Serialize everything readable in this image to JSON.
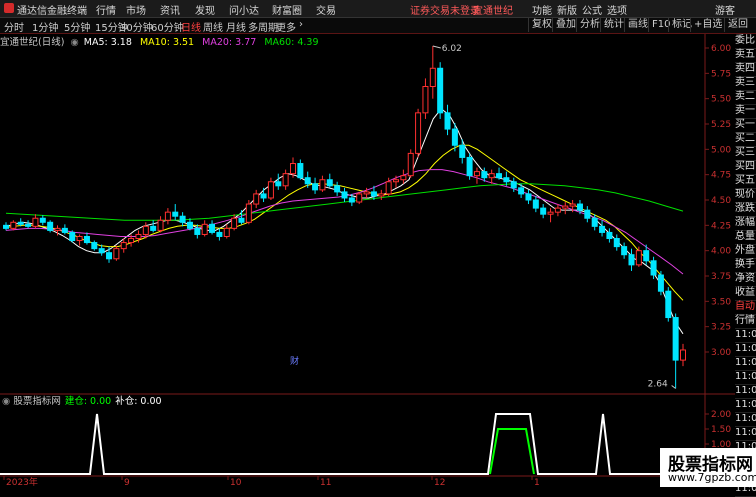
{
  "titlebar": {
    "app_name": "通达信金融终端",
    "menus": [
      "行情",
      "市场",
      "资讯",
      "发现",
      "问小达",
      "财富圈",
      "交易"
    ],
    "trade_warning": "证券交易未登录",
    "stock_name": "宜通世纪",
    "right_menus": [
      "功能",
      "新版",
      "公式",
      "选项"
    ],
    "user": "游客"
  },
  "toolbar": {
    "periods": [
      "分时",
      "1分钟",
      "5分钟",
      "15分钟",
      "30分钟",
      "60分钟",
      "日线",
      "周线",
      "月线",
      "多周期",
      "更多"
    ],
    "active_period": "日线",
    "right_buttons": [
      "复权",
      "叠加",
      "分析",
      "统计",
      "画线",
      "F10",
      "标记",
      "+自选",
      "返回"
    ]
  },
  "chart_header": {
    "stock": "宜通世纪(日线)",
    "ma": [
      {
        "label": "MA5: 3.18",
        "color": "#ffffff"
      },
      {
        "label": "MA10: 3.51",
        "color": "#ffff00"
      },
      {
        "label": "MA20: 3.77",
        "color": "#e040e0"
      },
      {
        "label": "MA60: 4.39",
        "color": "#00e000"
      }
    ]
  },
  "right_panel": {
    "labels": [
      "委比",
      "卖五",
      "卖四",
      "卖三",
      "卖二",
      "卖一",
      "买一",
      "买二",
      "买三",
      "买四",
      "买五",
      "现价",
      "涨跌",
      "涨幅",
      "总量",
      "外盘",
      "换手",
      "净资",
      "收益",
      "自动",
      "行情",
      "11:0",
      "11:0",
      "11:0",
      "11:0",
      "11:0",
      "11:0",
      "11:0",
      "11:0",
      "11:0",
      "11:0",
      "11:0",
      "11:0"
    ],
    "highlight": "自动"
  },
  "indicator": {
    "name": "股票指标网",
    "build_label": "建仓: 0.00",
    "add_label": "补仓: 0.00",
    "y_ticks": [
      "2.00",
      "1.50",
      "1.00",
      "0.50"
    ],
    "colors": {
      "build": "#00ff00",
      "add": "#ffffff"
    }
  },
  "markers": {
    "cai": "财",
    "high": "6.02",
    "low": "2.64"
  },
  "x_axis": {
    "ticks": [
      "2023年",
      "9",
      "10",
      "11",
      "12",
      "1"
    ]
  },
  "watermark": {
    "title": "股票指标网",
    "url": "www.7gpzb.com"
  },
  "chart_data": {
    "type": "candlestick",
    "y_ticks": [
      6.0,
      5.75,
      5.5,
      5.25,
      5.0,
      4.75,
      4.5,
      4.25,
      4.0,
      3.75,
      3.5,
      3.25,
      3.0
    ],
    "ylim": [
      2.6,
      6.05
    ],
    "candles": [
      [
        4.25,
        4.28,
        4.2,
        4.22
      ],
      [
        4.22,
        4.3,
        4.2,
        4.28
      ],
      [
        4.28,
        4.32,
        4.24,
        4.26
      ],
      [
        4.26,
        4.3,
        4.22,
        4.24
      ],
      [
        4.24,
        4.36,
        4.22,
        4.32
      ],
      [
        4.32,
        4.35,
        4.25,
        4.28
      ],
      [
        4.28,
        4.3,
        4.18,
        4.2
      ],
      [
        4.2,
        4.25,
        4.15,
        4.22
      ],
      [
        4.22,
        4.26,
        4.16,
        4.18
      ],
      [
        4.18,
        4.2,
        4.08,
        4.1
      ],
      [
        4.1,
        4.16,
        4.05,
        4.14
      ],
      [
        4.14,
        4.18,
        4.06,
        4.08
      ],
      [
        4.08,
        4.1,
        4.0,
        4.02
      ],
      [
        4.02,
        4.06,
        3.95,
        3.98
      ],
      [
        3.98,
        4.04,
        3.88,
        3.92
      ],
      [
        3.92,
        4.05,
        3.9,
        4.02
      ],
      [
        4.02,
        4.12,
        3.98,
        4.08
      ],
      [
        4.08,
        4.16,
        4.04,
        4.12
      ],
      [
        4.12,
        4.2,
        4.08,
        4.16
      ],
      [
        4.16,
        4.28,
        4.12,
        4.24
      ],
      [
        4.24,
        4.3,
        4.18,
        4.2
      ],
      [
        4.2,
        4.34,
        4.18,
        4.3
      ],
      [
        4.3,
        4.42,
        4.26,
        4.38
      ],
      [
        4.38,
        4.46,
        4.3,
        4.34
      ],
      [
        4.34,
        4.38,
        4.24,
        4.28
      ],
      [
        4.28,
        4.32,
        4.2,
        4.22
      ],
      [
        4.22,
        4.26,
        4.12,
        4.16
      ],
      [
        4.16,
        4.3,
        4.14,
        4.26
      ],
      [
        4.26,
        4.3,
        4.16,
        4.18
      ],
      [
        4.18,
        4.22,
        4.1,
        4.14
      ],
      [
        4.14,
        4.26,
        4.12,
        4.22
      ],
      [
        4.22,
        4.36,
        4.2,
        4.32
      ],
      [
        4.32,
        4.4,
        4.26,
        4.28
      ],
      [
        4.28,
        4.5,
        4.26,
        4.46
      ],
      [
        4.46,
        4.6,
        4.42,
        4.56
      ],
      [
        4.56,
        4.62,
        4.48,
        4.52
      ],
      [
        4.52,
        4.72,
        4.5,
        4.68
      ],
      [
        4.68,
        4.76,
        4.6,
        4.64
      ],
      [
        4.64,
        4.8,
        4.6,
        4.76
      ],
      [
        4.76,
        4.92,
        4.72,
        4.86
      ],
      [
        4.86,
        4.9,
        4.7,
        4.72
      ],
      [
        4.72,
        4.78,
        4.62,
        4.66
      ],
      [
        4.66,
        4.72,
        4.56,
        4.6
      ],
      [
        4.6,
        4.74,
        4.58,
        4.7
      ],
      [
        4.7,
        4.76,
        4.62,
        4.64
      ],
      [
        4.64,
        4.68,
        4.54,
        4.58
      ],
      [
        4.58,
        4.62,
        4.48,
        4.52
      ],
      [
        4.52,
        4.56,
        4.44,
        4.48
      ],
      [
        4.48,
        4.58,
        4.46,
        4.56
      ],
      [
        4.56,
        4.62,
        4.52,
        4.58
      ],
      [
        4.58,
        4.64,
        4.5,
        4.54
      ],
      [
        4.54,
        4.6,
        4.5,
        4.56
      ],
      [
        4.56,
        4.72,
        4.54,
        4.68
      ],
      [
        4.68,
        4.74,
        4.62,
        4.7
      ],
      [
        4.7,
        4.8,
        4.66,
        4.74
      ],
      [
        4.74,
        5.0,
        4.72,
        4.96
      ],
      [
        4.96,
        5.4,
        4.92,
        5.36
      ],
      [
        5.36,
        5.7,
        5.3,
        5.62
      ],
      [
        5.62,
        6.02,
        5.5,
        5.8
      ],
      [
        5.8,
        5.86,
        5.3,
        5.36
      ],
      [
        5.36,
        5.44,
        5.14,
        5.2
      ],
      [
        5.2,
        5.26,
        4.98,
        5.04
      ],
      [
        5.04,
        5.1,
        4.86,
        4.92
      ],
      [
        4.92,
        4.96,
        4.7,
        4.74
      ],
      [
        4.74,
        4.82,
        4.66,
        4.78
      ],
      [
        4.78,
        4.82,
        4.68,
        4.72
      ],
      [
        4.72,
        4.8,
        4.66,
        4.76
      ],
      [
        4.76,
        4.82,
        4.7,
        4.72
      ],
      [
        4.72,
        4.78,
        4.64,
        4.68
      ],
      [
        4.68,
        4.72,
        4.58,
        4.62
      ],
      [
        4.62,
        4.66,
        4.52,
        4.56
      ],
      [
        4.56,
        4.6,
        4.46,
        4.5
      ],
      [
        4.5,
        4.54,
        4.38,
        4.42
      ],
      [
        4.42,
        4.46,
        4.32,
        4.36
      ],
      [
        4.36,
        4.42,
        4.28,
        4.38
      ],
      [
        4.38,
        4.46,
        4.34,
        4.42
      ],
      [
        4.42,
        4.48,
        4.36,
        4.44
      ],
      [
        4.44,
        4.5,
        4.38,
        4.46
      ],
      [
        4.46,
        4.5,
        4.36,
        4.4
      ],
      [
        4.4,
        4.44,
        4.28,
        4.32
      ],
      [
        4.32,
        4.36,
        4.2,
        4.24
      ],
      [
        4.24,
        4.3,
        4.14,
        4.18
      ],
      [
        4.18,
        4.22,
        4.08,
        4.12
      ],
      [
        4.12,
        4.16,
        4.0,
        4.04
      ],
      [
        4.04,
        4.08,
        3.92,
        3.96
      ],
      [
        3.96,
        4.02,
        3.8,
        3.86
      ],
      [
        3.86,
        4.04,
        3.84,
        4.0
      ],
      [
        4.0,
        4.06,
        3.86,
        3.9
      ],
      [
        3.9,
        3.94,
        3.72,
        3.76
      ],
      [
        3.76,
        3.8,
        3.56,
        3.6
      ],
      [
        3.6,
        3.64,
        3.3,
        3.34
      ],
      [
        3.34,
        3.38,
        2.64,
        2.92
      ],
      [
        2.92,
        3.08,
        2.86,
        3.02
      ]
    ],
    "ma": {
      "MA5": [
        4.24,
        4.26,
        4.28,
        4.27,
        4.25,
        4.22,
        4.19,
        4.15,
        4.1,
        4.04,
        4.0,
        3.98,
        3.98,
        4.02,
        4.08,
        4.14,
        4.2,
        4.24,
        4.26,
        4.28,
        4.3,
        4.3,
        4.28,
        4.25,
        4.22,
        4.2,
        4.2,
        4.24,
        4.3,
        4.36,
        4.44,
        4.52,
        4.6,
        4.66,
        4.72,
        4.76,
        4.74,
        4.7,
        4.66,
        4.64,
        4.62,
        4.6,
        4.56,
        4.54,
        4.52,
        4.52,
        4.54,
        4.56,
        4.6,
        4.64,
        4.7,
        4.9,
        5.1,
        5.3,
        5.4,
        5.34,
        5.2,
        5.02,
        4.9,
        4.8,
        4.74,
        4.72,
        4.7,
        4.68,
        4.64,
        4.6,
        4.54,
        4.48,
        4.42,
        4.4,
        4.4,
        4.4,
        4.38,
        4.32,
        4.24,
        4.16,
        4.08,
        4.0,
        3.92,
        3.88,
        3.82,
        3.7,
        3.5,
        3.3,
        3.18
      ],
      "MA10": [
        4.23,
        4.24,
        4.25,
        4.25,
        4.24,
        4.23,
        4.21,
        4.18,
        4.15,
        4.11,
        4.08,
        4.05,
        4.04,
        4.04,
        4.06,
        4.09,
        4.12,
        4.16,
        4.19,
        4.22,
        4.24,
        4.25,
        4.25,
        4.24,
        4.23,
        4.22,
        4.22,
        4.24,
        4.27,
        4.31,
        4.37,
        4.43,
        4.49,
        4.55,
        4.6,
        4.64,
        4.66,
        4.66,
        4.65,
        4.64,
        4.62,
        4.6,
        4.58,
        4.56,
        4.55,
        4.56,
        4.58,
        4.62,
        4.68,
        4.76,
        4.86,
        4.94,
        5.0,
        5.04,
        5.04,
        5.0,
        4.94,
        4.88,
        4.82,
        4.76,
        4.7,
        4.66,
        4.62,
        4.58,
        4.54,
        4.5,
        4.46,
        4.42,
        4.38,
        4.34,
        4.3,
        4.24,
        4.16,
        4.08,
        3.98,
        3.9,
        3.8,
        3.7,
        3.6,
        3.51
      ],
      "MA20": [
        4.2,
        4.21,
        4.22,
        4.22,
        4.21,
        4.2,
        4.18,
        4.17,
        4.16,
        4.15,
        4.14,
        4.14,
        4.14,
        4.15,
        4.17,
        4.19,
        4.21,
        4.23,
        4.26,
        4.29,
        4.32,
        4.36,
        4.4,
        4.44,
        4.47,
        4.49,
        4.5,
        4.51,
        4.52,
        4.53,
        4.55,
        4.58,
        4.62,
        4.67,
        4.72,
        4.76,
        4.79,
        4.8,
        4.8,
        4.78,
        4.75,
        4.72,
        4.68,
        4.65,
        4.62,
        4.58,
        4.54,
        4.5,
        4.46,
        4.42,
        4.38,
        4.34,
        4.3,
        4.24,
        4.18,
        4.1,
        4.02,
        3.94,
        3.86,
        3.77
      ],
      "MA60": [
        4.37,
        4.36,
        4.35,
        4.34,
        4.33,
        4.32,
        4.31,
        4.3,
        4.3,
        4.3,
        4.3,
        4.31,
        4.32,
        4.34,
        4.36,
        4.38,
        4.4,
        4.42,
        4.44,
        4.46,
        4.48,
        4.5,
        4.52,
        4.54,
        4.56,
        4.58,
        4.6,
        4.62,
        4.64,
        4.65,
        4.66,
        4.66,
        4.65,
        4.64,
        4.62,
        4.6,
        4.57,
        4.53,
        4.49,
        4.44,
        4.39
      ]
    },
    "indicator_series": {
      "build": [
        [
          490,
          0
        ],
        [
          498,
          1.5
        ],
        [
          526,
          1.5
        ],
        [
          534,
          0
        ]
      ],
      "add_spikes": [
        97,
        492,
        534,
        603
      ],
      "ylim": [
        0,
        2.2
      ]
    }
  }
}
